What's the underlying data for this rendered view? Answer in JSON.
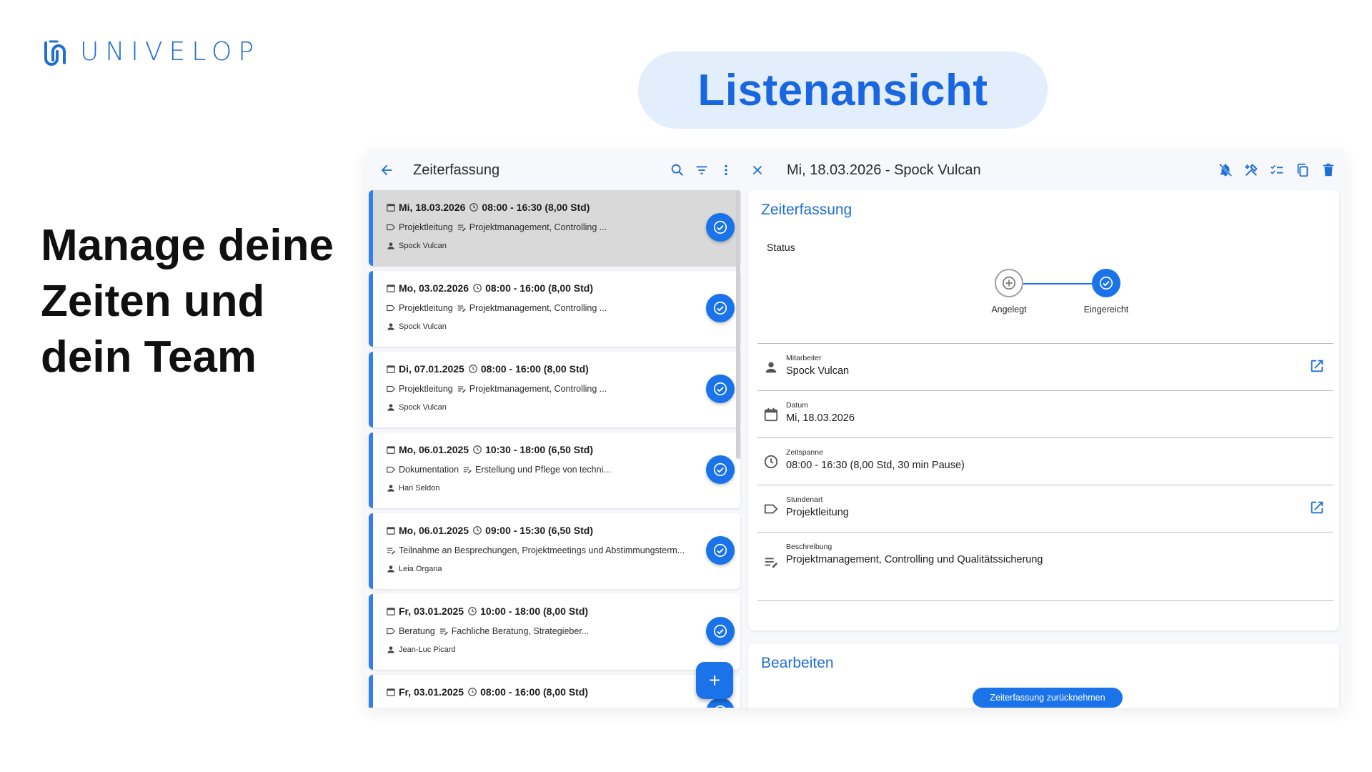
{
  "brand": {
    "name": "UNIVELOP",
    "color": "#1f6ed4"
  },
  "hero": {
    "label": "Listenansicht"
  },
  "headline": {
    "line1": "Manage deine",
    "line2": "Zeiten und",
    "line3": "dein Team"
  },
  "list": {
    "title": "Zeiterfassung",
    "icons": [
      "back-arrow-icon",
      "search-icon",
      "filter-icon",
      "more-vert-icon"
    ],
    "items": [
      {
        "date": "Mi, 18.03.2026",
        "time": "08:00 - 16:30 (8,00 Std)",
        "type": "Projektleitung",
        "description": "Projektmanagement, Controlling ...",
        "person": "Spock Vulcan",
        "selected": true
      },
      {
        "date": "Mo, 03.02.2026",
        "time": "08:00 - 16:00 (8,00 Std)",
        "type": "Projektleitung",
        "description": "Projektmanagement, Controlling ...",
        "person": "Spock Vulcan"
      },
      {
        "date": "Di, 07.01.2025",
        "time": "08:00 - 16:00 (8,00 Std)",
        "type": "Projektleitung",
        "description": "Projektmanagement, Controlling ...",
        "person": "Spock Vulcan"
      },
      {
        "date": "Mo, 06.01.2025",
        "time": "10:30 - 18:00 (6,50 Std)",
        "type": "Dokumentation",
        "description": "Erstellung und Pflege von techni...",
        "person": "Hari Seldon"
      },
      {
        "date": "Mo, 06.01.2025",
        "time": "09:00 - 15:30 (6,50 Std)",
        "type": "",
        "description": "Teilnahme an Besprechungen, Projektmeetings und Abstimmungsterm...",
        "person": "Leia Organa"
      },
      {
        "date": "Fr, 03.01.2025",
        "time": "10:00 - 18:00 (8,00 Std)",
        "type": "Beratung",
        "description": "Fachliche Beratung, Strategieber...",
        "person": "Jean-Luc Picard"
      },
      {
        "date": "Fr, 03.01.2025",
        "time": "08:00 - 16:00 (8,00 Std)",
        "type": "",
        "description": "",
        "person": ""
      }
    ],
    "add_label": "+"
  },
  "detail": {
    "title": "Mi, 18.03.2026 - Spock Vulcan",
    "toolbar_icons": [
      "notifications-off-icon",
      "tools-icon",
      "checklist-icon",
      "copy-icon",
      "delete-icon"
    ],
    "section_title": "Zeiterfassung",
    "status_label": "Status",
    "steps": [
      {
        "label": "Angelegt",
        "state": "inactive"
      },
      {
        "label": "Eingereicht",
        "state": "active"
      }
    ],
    "fields": [
      {
        "label": "Mitarbeiter",
        "value": "Spock Vulcan",
        "icon": "person-icon",
        "link": true
      },
      {
        "label": "Datum",
        "value": "Mi, 18.03.2026",
        "icon": "calendar-icon",
        "link": false
      },
      {
        "label": "Zeitspanne",
        "value": "08:00 - 16:30 (8,00 Std, 30 min Pause)",
        "icon": "clock-icon",
        "link": false
      },
      {
        "label": "Stundenart",
        "value": "Projektleitung",
        "icon": "label-icon",
        "link": true
      },
      {
        "label": "Beschreibung",
        "value": "Projektmanagement, Controlling und Qualitätssicherung",
        "icon": "notes-icon",
        "link": false
      }
    ],
    "edit_title": "Bearbeiten",
    "edit_button": "Zeiterfassung zurücknehmen"
  },
  "colors": {
    "accent": "#1a73e8",
    "hero_bg": "#e2eefc",
    "selected_card": "#d9d9d9"
  }
}
